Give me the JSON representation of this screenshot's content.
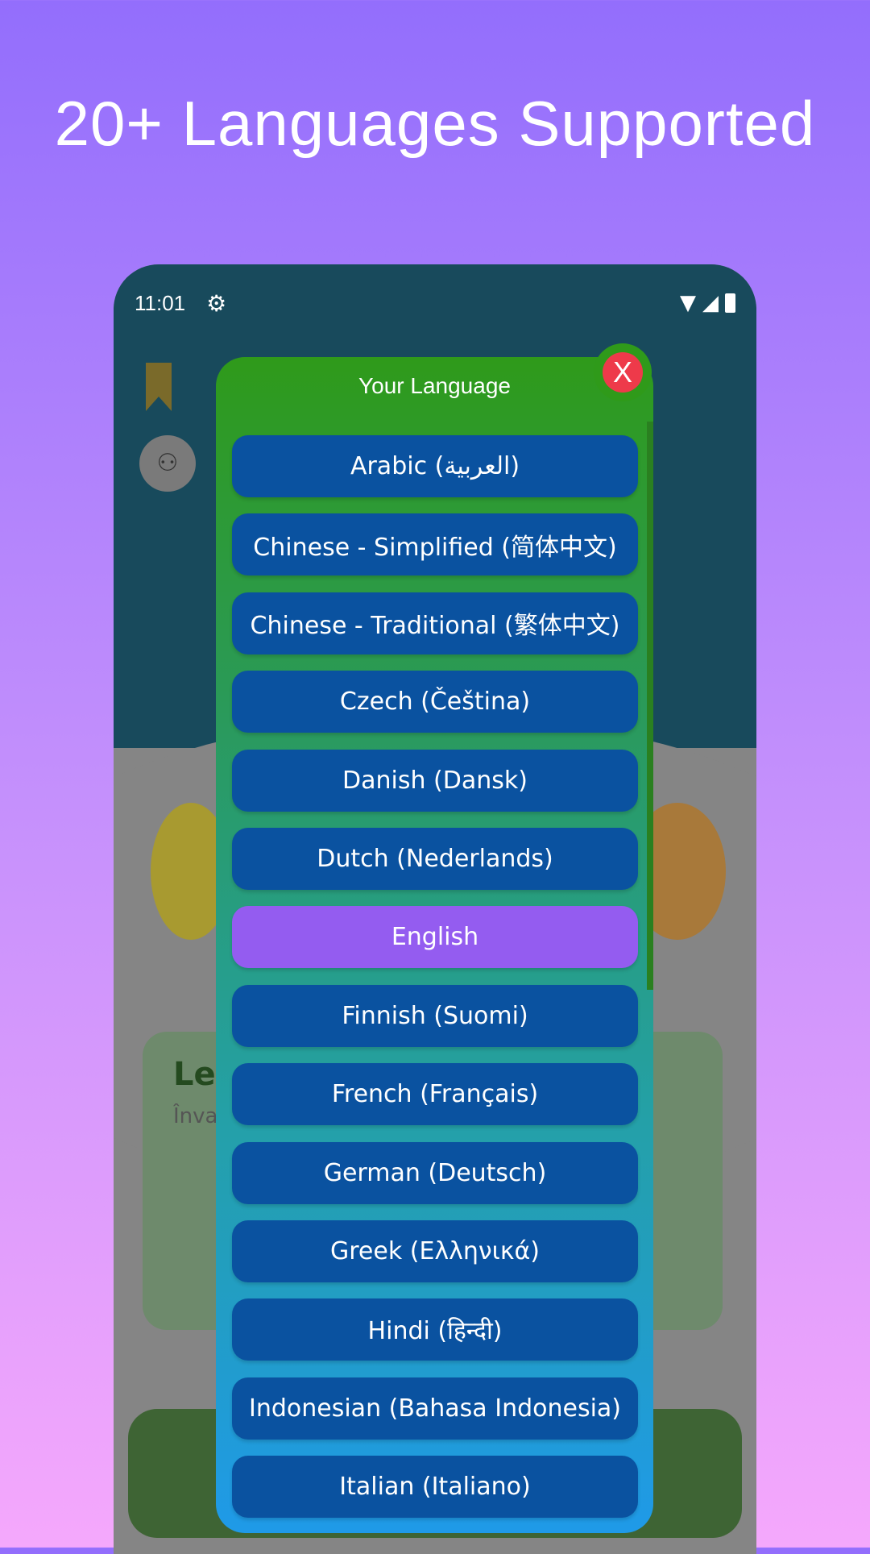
{
  "headline": "20+ Languages Supported",
  "status_bar": {
    "time": "11:01"
  },
  "background_app": {
    "card_title": "Lea",
    "card_subtitle": "Învat"
  },
  "dialog": {
    "title": "Your Language",
    "close_label": "X",
    "selected": "English",
    "languages": [
      "Arabic (العربية)",
      "Chinese - Simplified (简体中文)",
      "Chinese - Traditional (繁体中文)",
      "Czech (Čeština)",
      "Danish (Dansk)",
      "Dutch (Nederlands)",
      "English",
      "Finnish (Suomi)",
      "French (Français)",
      "German (Deutsch)",
      "Greek (Ελληνικά)",
      "Hindi (हिन्दी)",
      "Indonesian (Bahasa Indonesia)",
      "Italian (Italiano)"
    ]
  },
  "colors": {
    "dialog_header": "#2f9a1a",
    "button": "#0a52a0",
    "selected": "#945cf0",
    "close": "#ee3a4a"
  }
}
